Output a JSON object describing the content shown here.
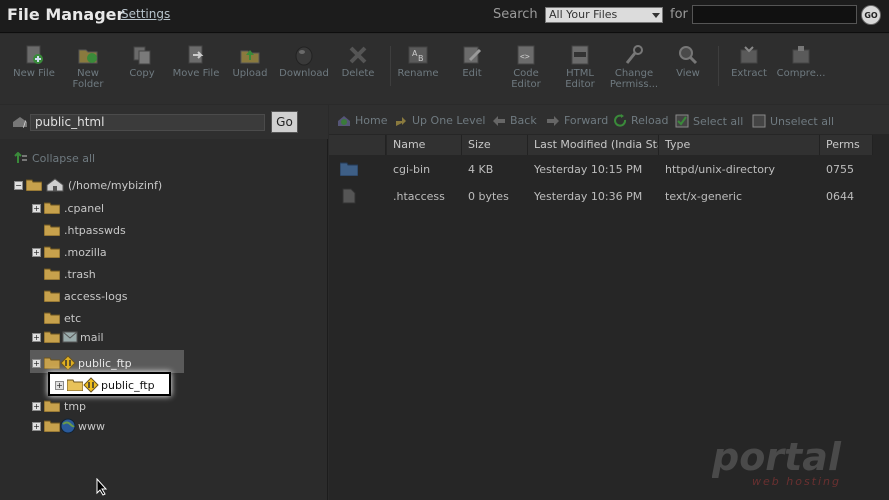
{
  "header": {
    "title": "File Manager",
    "settings": "Settings",
    "search_label": "Search",
    "search_scope": "All Your Files",
    "for_label": "for",
    "go": "GO"
  },
  "toolbar": {
    "new_file": [
      "New File"
    ],
    "new_folder": [
      "New",
      "Folder"
    ],
    "copy": [
      "Copy"
    ],
    "move_file": [
      "Move File"
    ],
    "upload": [
      "Upload"
    ],
    "download": [
      "Download"
    ],
    "delete": [
      "Delete"
    ],
    "rename": [
      "Rename"
    ],
    "edit": [
      "Edit"
    ],
    "code_editor": [
      "Code",
      "Editor"
    ],
    "html_editor": [
      "HTML",
      "Editor"
    ],
    "change_perms": [
      "Change",
      "Permiss..."
    ],
    "view": [
      "View"
    ],
    "extract": [
      "Extract"
    ],
    "compress": [
      "Compre..."
    ]
  },
  "path": {
    "value": "public_html",
    "go": "Go",
    "collapse_all": "Collapse all"
  },
  "tree": {
    "root": "(/home/mybizinf)",
    "items": [
      ".cpanel",
      ".htpasswds",
      ".mozilla",
      ".trash",
      "access-logs",
      "etc",
      "mail",
      "public_ftp",
      "tmp",
      "www"
    ],
    "callout_label": "public_ftp"
  },
  "nav": {
    "home": "Home",
    "up": "Up One Level",
    "back": "Back",
    "forward": "Forward",
    "reload": "Reload",
    "select_all": "Select all",
    "unselect_all": "Unselect all"
  },
  "table": {
    "columns": [
      "Name",
      "Size",
      "Last Modified (India Standard Time)",
      "Type",
      "Perms"
    ],
    "rows": [
      {
        "name": "cgi-bin",
        "size": "4 KB",
        "modified": "Yesterday 10:15 PM",
        "type": "httpd/unix-directory",
        "perms": "0755"
      },
      {
        "name": ".htaccess",
        "size": "0 bytes",
        "modified": "Yesterday 10:36 PM",
        "type": "text/x-generic",
        "perms": "0644"
      }
    ]
  },
  "watermark": {
    "brand": "portal",
    "sub": "web hosting"
  }
}
